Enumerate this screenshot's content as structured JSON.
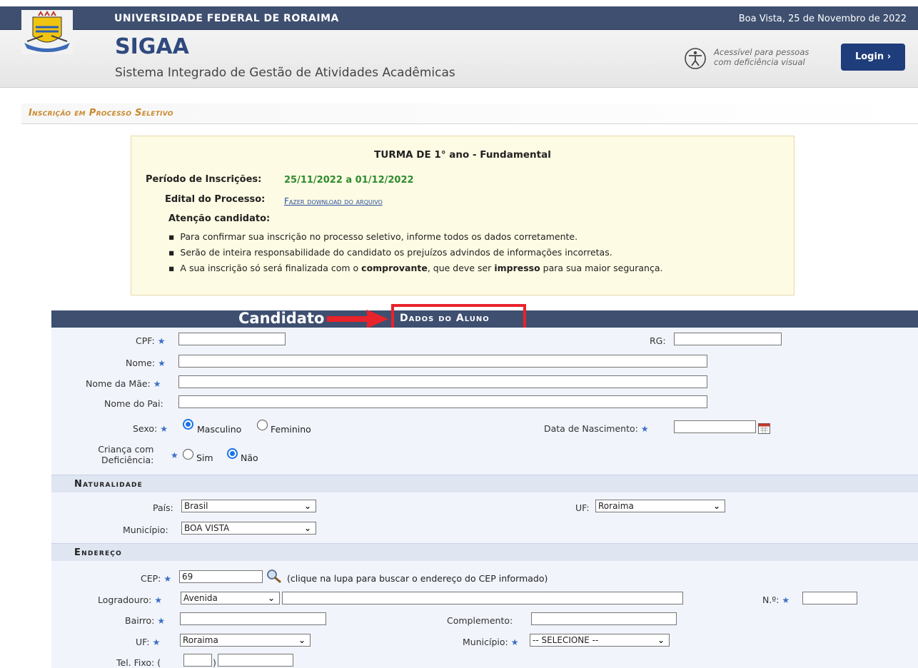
{
  "header": {
    "university": "UNIVERSIDADE FEDERAL DE RORAIMA",
    "date": "Boa Vista, 25 de Novembro de 2022",
    "app_name": "SIGAA",
    "app_subtitle": "Sistema Integrado de Gestão de Atividades Acadêmicas",
    "accessibility_text_1": "Acessível para pessoas",
    "accessibility_text_2": "com deficiência visual",
    "login_label": "Login  ›"
  },
  "page_title": "Inscrição em Processo Seletivo",
  "info_box": {
    "turma": "TURMA DE 1° ano - Fundamental",
    "periodo_label": "Período de Inscrições:",
    "periodo_value": "25/11/2022 a 01/12/2022",
    "edital_label": "Edital do Processo:",
    "edital_link": "Fazer download do arquivo",
    "atencao": "Atenção candidato:",
    "bullet_1": "Para confirmar sua inscrição no processo seletivo, informe todos os dados corretamente.",
    "bullet_2": "Serão de inteira responsabilidade do candidato os prejuízos advindos de informações incorretas.",
    "bullet_3_a": "A sua inscrição só será finalizada com o ",
    "bullet_3_b": "comprovante",
    "bullet_3_c": ", que deve ser ",
    "bullet_3_d": "impresso",
    "bullet_3_e": " para sua maior segurança."
  },
  "annotation": {
    "candidato": "Candidato"
  },
  "form": {
    "section_title": "Dados do Aluno",
    "cpf_label": "CPF:",
    "rg_label": "RG:",
    "nome_label": "Nome:",
    "mae_label": "Nome da Mãe:",
    "pai_label": "Nome do Pai:",
    "sexo_label": "Sexo:",
    "sexo_masculino": "Masculino",
    "sexo_feminino": "Feminino",
    "nascimento_label": "Data de Nascimento:",
    "deficiencia_label_1": "Criança com",
    "deficiencia_label_2": "Deficiência:",
    "sim": "Sim",
    "nao": "Não",
    "naturalidade_title": "Naturalidade",
    "pais_label": "País:",
    "pais_value": "Brasil",
    "uf_label": "UF:",
    "uf_value": "Roraima",
    "municipio_label": "Município:",
    "municipio_value": "BOA VISTA",
    "endereco_title": "Endereço",
    "cep_label": "CEP:",
    "cep_value": "69",
    "cep_hint": "(clique na lupa para buscar o endereço do CEP informado)",
    "logradouro_label": "Logradouro:",
    "logradouro_tipo": "Avenida",
    "numero_label": "N.º:",
    "bairro_label": "Bairro:",
    "complemento_label": "Complemento:",
    "end_uf_label": "UF:",
    "end_uf_value": "Roraima",
    "end_municipio_label": "Município:",
    "end_municipio_value": "-- SELECIONE --",
    "tel_label": "Tel. Fixo:"
  },
  "colors": {
    "header_bar": "#3e4f70",
    "accent_orange": "#c9892b",
    "highlight_red": "#e8232b",
    "period_green": "#2e8b2e"
  }
}
